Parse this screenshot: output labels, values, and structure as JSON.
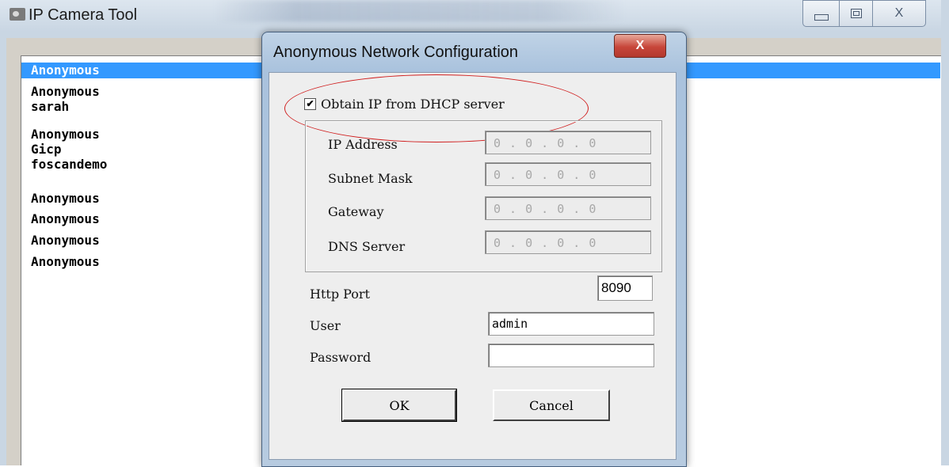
{
  "window": {
    "title": "IP Camera Tool",
    "icon": "camera-icon"
  },
  "controls": {
    "minimize_icon": "minimize-icon",
    "maximize_icon": "maximize-icon",
    "close_glyph": "X"
  },
  "devices": [
    "Anonymous",
    "Anonymous",
    "sarah",
    "Anonymous",
    "Gicp",
    "foscandemo",
    "Anonymous",
    "Anonymous",
    "Anonymous",
    "Anonymous"
  ],
  "selected_device_index": 0,
  "dialog": {
    "title": "Anonymous Network Configuration",
    "close_glyph": "X",
    "dhcp_label": "Obtain IP from DHCP server",
    "dhcp_checked": true,
    "dhcp_check_glyph": "✔",
    "ip_address_label": "IP Address",
    "ip_address_value": "0 . 0 . 0 . 0",
    "subnet_mask_label": "Subnet Mask",
    "subnet_mask_value": "0 . 0 . 0 . 0",
    "gateway_label": "Gateway",
    "gateway_value": "0 . 0 . 0 . 0",
    "dns_label": "DNS Server",
    "dns_value": "0 . 0 . 0 . 0",
    "http_port_label": "Http Port",
    "http_port_value": "8090",
    "user_label": "User",
    "user_value": "admin",
    "password_label": "Password",
    "password_value": "",
    "ok_label": "OK",
    "cancel_label": "Cancel"
  },
  "colors": {
    "selection": "#3399ff",
    "highlight_annotation": "#d01f1f",
    "dialog_close": "#c7463a"
  }
}
